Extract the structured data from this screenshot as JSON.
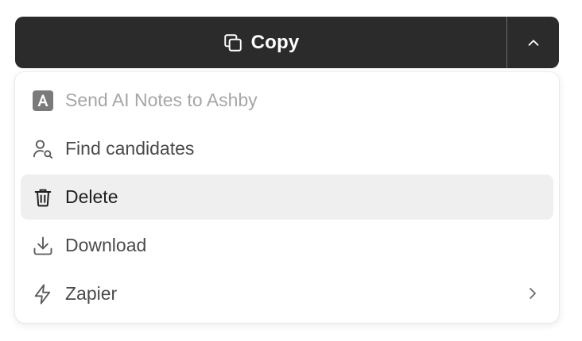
{
  "copy_button": {
    "label": "Copy",
    "main_icon": "copy-icon",
    "toggle_icon": "chevron-up-icon"
  },
  "menu": {
    "items": [
      {
        "label": "Send AI Notes to Ashby",
        "icon": "ashby-logo-icon",
        "disabled": true
      },
      {
        "label": "Find candidates",
        "icon": "user-search-icon"
      },
      {
        "label": "Delete",
        "icon": "trash-icon",
        "highlighted": true
      },
      {
        "label": "Download",
        "icon": "download-icon"
      },
      {
        "label": "Zapier",
        "icon": "zap-icon",
        "submenu_icon": "chevron-right-icon"
      }
    ]
  },
  "colors": {
    "button_bg": "#2b2b2b",
    "highlight_bg": "#efefef",
    "disabled_text": "#a6a6a6"
  }
}
